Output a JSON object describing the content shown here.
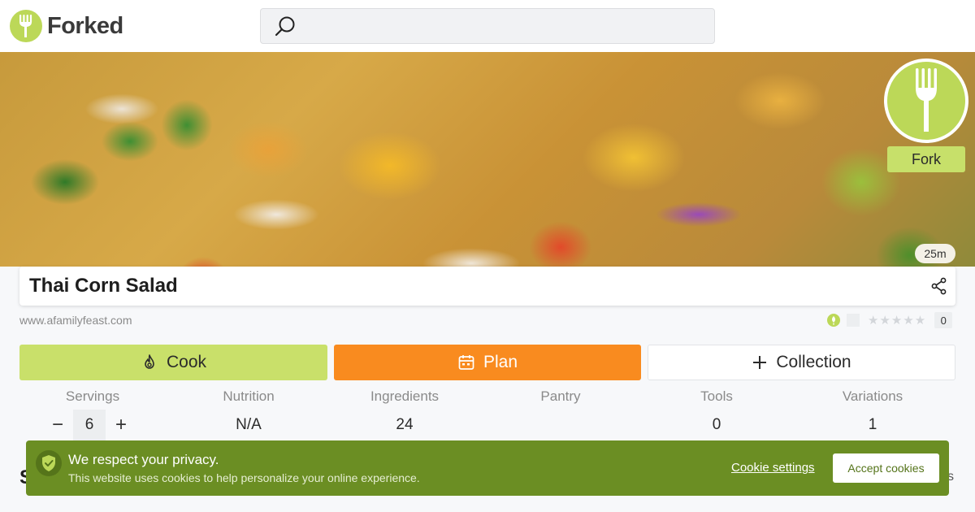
{
  "header": {
    "brand": "Forked",
    "search_placeholder": ""
  },
  "hero": {
    "fork_label": "Fork",
    "time": "25m"
  },
  "recipe": {
    "title": "Thai Corn Salad",
    "source": "www.afamilyfeast.com",
    "rating_stars": "★★★★★",
    "rating_count": "0"
  },
  "actions": {
    "cook": "Cook",
    "plan": "Plan",
    "collection": "Collection"
  },
  "stats": {
    "servings_label": "Servings",
    "servings_value": "6",
    "minus": "−",
    "plus": "+",
    "nutrition_label": "Nutrition",
    "nutrition_value": "N/A",
    "ingredients_label": "Ingredients",
    "ingredients_value": "24",
    "pantry_label": "Pantry",
    "pantry_value": "",
    "tools_label": "Tools",
    "tools_value": "0",
    "variations_label": "Variations",
    "variations_value": "1"
  },
  "peek": {
    "left": "S",
    "right": "s"
  },
  "cookie": {
    "title": "We respect your privacy.",
    "text": "This website uses cookies to help personalize your online experience.",
    "settings": "Cookie settings",
    "accept": "Accept cookies"
  },
  "colors": {
    "brand_green": "#bcd858",
    "cook_green": "#c9e06a",
    "plan_orange": "#f98b1f",
    "cookie_green": "#6b8e23"
  },
  "icons": {
    "logo": "fork-icon",
    "search": "search-icon",
    "share": "share-icon",
    "cook": "flame-icon",
    "plan": "calendar-icon",
    "collection": "plus-icon",
    "cookie": "shield-check-icon"
  }
}
